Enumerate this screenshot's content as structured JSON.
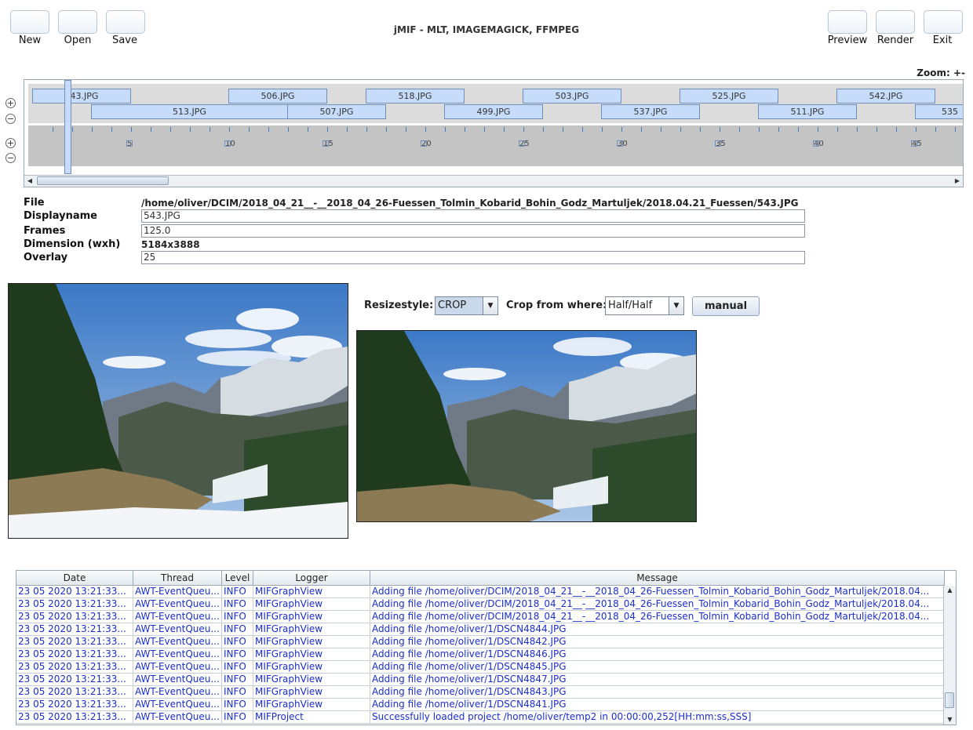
{
  "toolbar": {
    "title": "jMIF - MLT, IMAGEMAGICK, FFMPEG",
    "buttons": [
      {
        "label": "New"
      },
      {
        "label": "Open"
      },
      {
        "label": "Save"
      },
      {
        "label": "Preview"
      },
      {
        "label": "Render"
      },
      {
        "label": "Exit"
      }
    ],
    "zoom_label": "Zoom: +-"
  },
  "timeline": {
    "clips_row1": [
      "543.JPG",
      "506.JPG",
      "518.JPG",
      "503.JPG",
      "525.JPG",
      "542.JPG"
    ],
    "clips_row2": [
      "513.JPG",
      "507.JPG",
      "499.JPG",
      "537.JPG",
      "511.JPG",
      "535"
    ],
    "tick_labels": [
      "5",
      "10",
      "15",
      "20",
      "25",
      "30",
      "35",
      "40",
      "45"
    ],
    "zoom_in_symbol": "+",
    "zoom_out_symbol": "−"
  },
  "properties": {
    "file_label": "File",
    "file_value": "/home/oliver/DCIM/2018_04_21__-__2018_04_26-Fuessen_Tolmin_Kobarid_Bohin_Godz_Martuljek/2018.04.21_Fuessen/543.JPG",
    "displayname_label": "Displayname",
    "displayname_value": "543.JPG",
    "frames_label": "Frames",
    "frames_value": "125.0",
    "dimension_label": "Dimension (wxh)",
    "dimension_value": "5184x3888",
    "overlay_label": "Overlay",
    "overlay_value": "25"
  },
  "resize": {
    "resizestyle_label": "Resizestyle:",
    "resizestyle_value": "CROP",
    "crop_label": "Crop from where:",
    "crop_value": "Half/Half",
    "manual_label": "manual"
  },
  "log": {
    "columns": [
      "Date",
      "Thread",
      "Level",
      "Logger",
      "Message"
    ],
    "rows": [
      {
        "date": "23 05 2020 13:21:33...",
        "thread": "AWT-EventQueu...",
        "level": "INFO",
        "logger": "MIFGraphView",
        "message": "Adding file /home/oliver/DCIM/2018_04_21__-__2018_04_26-Fuessen_Tolmin_Kobarid_Bohin_Godz_Martuljek/2018.04..."
      },
      {
        "date": "23 05 2020 13:21:33...",
        "thread": "AWT-EventQueu...",
        "level": "INFO",
        "logger": "MIFGraphView",
        "message": "Adding file /home/oliver/DCIM/2018_04_21__-__2018_04_26-Fuessen_Tolmin_Kobarid_Bohin_Godz_Martuljek/2018.04..."
      },
      {
        "date": "23 05 2020 13:21:33...",
        "thread": "AWT-EventQueu...",
        "level": "INFO",
        "logger": "MIFGraphView",
        "message": "Adding file /home/oliver/DCIM/2018_04_21__-__2018_04_26-Fuessen_Tolmin_Kobarid_Bohin_Godz_Martuljek/2018.04..."
      },
      {
        "date": "23 05 2020 13:21:33...",
        "thread": "AWT-EventQueu...",
        "level": "INFO",
        "logger": "MIFGraphView",
        "message": "Adding file /home/oliver/1/DSCN4844.JPG"
      },
      {
        "date": "23 05 2020 13:21:33...",
        "thread": "AWT-EventQueu...",
        "level": "INFO",
        "logger": "MIFGraphView",
        "message": "Adding file /home/oliver/1/DSCN4842.JPG"
      },
      {
        "date": "23 05 2020 13:21:33...",
        "thread": "AWT-EventQueu...",
        "level": "INFO",
        "logger": "MIFGraphView",
        "message": "Adding file /home/oliver/1/DSCN4846.JPG"
      },
      {
        "date": "23 05 2020 13:21:33...",
        "thread": "AWT-EventQueu...",
        "level": "INFO",
        "logger": "MIFGraphView",
        "message": "Adding file /home/oliver/1/DSCN4845.JPG"
      },
      {
        "date": "23 05 2020 13:21:33...",
        "thread": "AWT-EventQueu...",
        "level": "INFO",
        "logger": "MIFGraphView",
        "message": "Adding file /home/oliver/1/DSCN4847.JPG"
      },
      {
        "date": "23 05 2020 13:21:33...",
        "thread": "AWT-EventQueu...",
        "level": "INFO",
        "logger": "MIFGraphView",
        "message": "Adding file /home/oliver/1/DSCN4843.JPG"
      },
      {
        "date": "23 05 2020 13:21:33...",
        "thread": "AWT-EventQueu...",
        "level": "INFO",
        "logger": "MIFGraphView",
        "message": "Adding file /home/oliver/1/DSCN4841.JPG"
      },
      {
        "date": "23 05 2020 13:21:33...",
        "thread": "AWT-EventQueu...",
        "level": "INFO",
        "logger": "MIFProject",
        "message": "Successfully loaded project /home/oliver/temp2 in 00:00:00,252[HH:mm:ss,SSS]"
      }
    ]
  },
  "colors": {
    "clip_fill": "#c6dcfa",
    "clip_border": "#6f8fbf",
    "log_text": "#1a2ecc"
  }
}
